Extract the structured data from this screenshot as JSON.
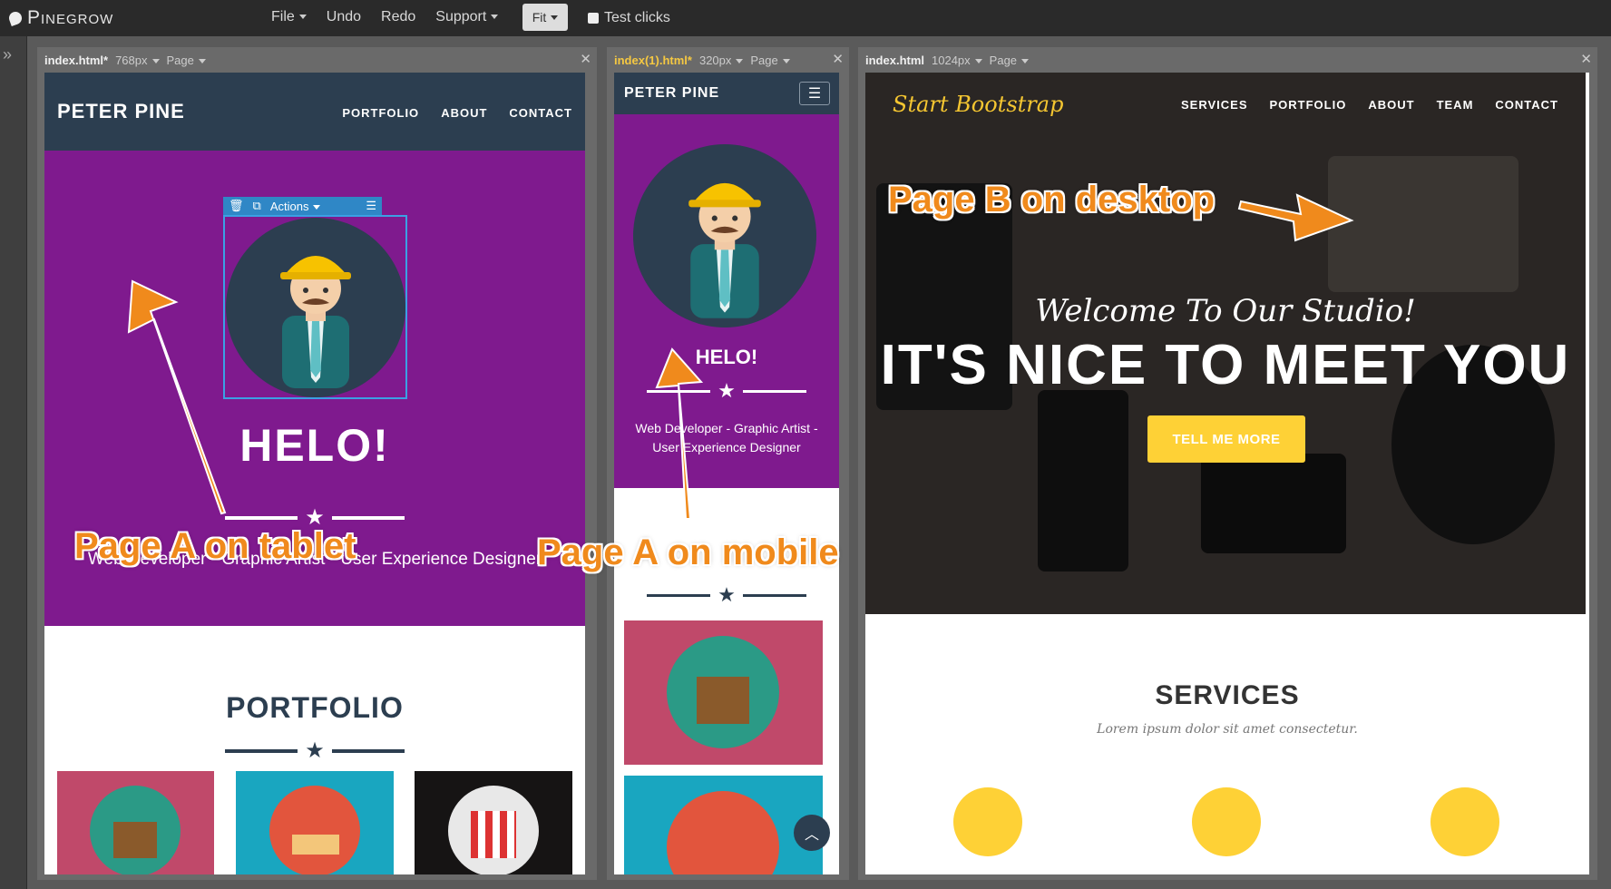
{
  "app": {
    "name": "Pinegrow",
    "menu": [
      "File",
      "Undo",
      "Redo",
      "Support"
    ],
    "fit_label": "Fit",
    "test_clicks_label": "Test clicks"
  },
  "panels": [
    {
      "filename": "index.html*",
      "width_label": "768px",
      "page_label": "Page"
    },
    {
      "filename": "index(1).html*",
      "width_label": "320px",
      "page_label": "Page"
    },
    {
      "filename": "index.html",
      "width_label": "1024px",
      "page_label": "Page"
    }
  ],
  "page_a": {
    "brand": "PETER PINE",
    "nav": [
      "PORTFOLIO",
      "ABOUT",
      "CONTACT"
    ],
    "heading": "HELO!",
    "tagline_tablet": "Web Developer - Graphic Artist - User Experience Designer",
    "tagline_mobile_1": "Web Developer - Graphic Artist -",
    "tagline_mobile_2": "User Experience Designer",
    "portfolio_title": "PORTFOLIO",
    "actions_label": "Actions"
  },
  "page_b": {
    "brand": "Start Bootstrap",
    "nav": [
      "SERVICES",
      "PORTFOLIO",
      "ABOUT",
      "TEAM",
      "CONTACT"
    ],
    "welcome": "Welcome To Our Studio!",
    "headline": "IT'S NICE TO MEET YOU",
    "button": "TELL ME MORE",
    "services_title": "SERVICES",
    "services_sub": "Lorem ipsum dolor sit amet consectetur."
  },
  "annotations": {
    "tablet": "Page A on tablet",
    "mobile": "Page A on mobile",
    "desktop": "Page B on desktop"
  },
  "colors": {
    "navy": "#2c3e50",
    "purple": "#7f1a8e",
    "annotation": "#f08a1c",
    "bootstrap_yellow": "#fed136"
  }
}
